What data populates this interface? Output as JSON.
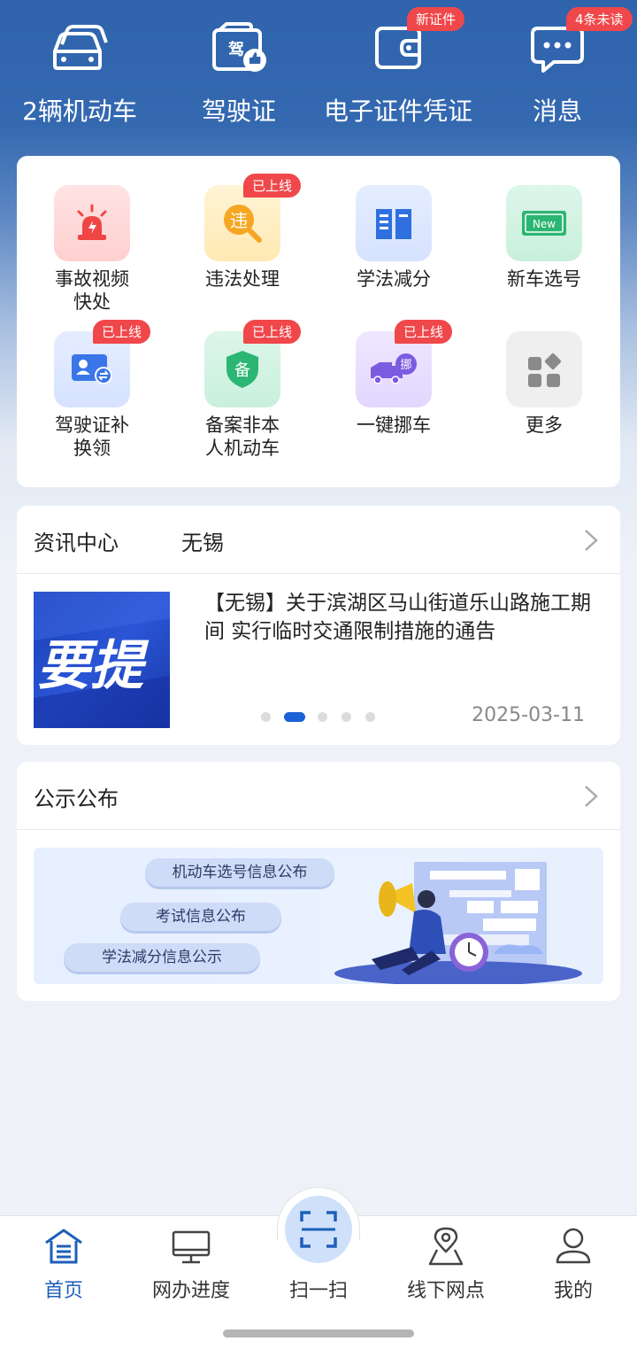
{
  "header": {
    "items": [
      {
        "label": "2辆机动车",
        "icon": "car-icon",
        "badge": ""
      },
      {
        "label": "驾驶证",
        "icon": "license-icon",
        "badge": ""
      },
      {
        "label": "电子证件凭证",
        "icon": "wallet-icon",
        "badge": "新证件"
      },
      {
        "label": "消息",
        "icon": "message-icon",
        "badge": "4条未读"
      }
    ]
  },
  "services": {
    "items": [
      {
        "label": "事故视频快处",
        "icon": "siren-icon",
        "badge": ""
      },
      {
        "label": "违法处理",
        "icon": "violation-icon",
        "badge": "已上线",
        "glyph": "违"
      },
      {
        "label": "学法减分",
        "icon": "book-icon",
        "badge": ""
      },
      {
        "label": "新车选号",
        "icon": "new-plate-icon",
        "badge": "",
        "glyph": "New"
      },
      {
        "label": "驾驶证补换领",
        "icon": "license-replace-icon",
        "badge": "已上线"
      },
      {
        "label": "备案非本人机动车",
        "icon": "record-shield-icon",
        "badge": "已上线",
        "glyph": "备"
      },
      {
        "label": "一键挪车",
        "icon": "move-truck-icon",
        "badge": "已上线",
        "glyph": "挪"
      },
      {
        "label": "更多",
        "icon": "more-grid-icon",
        "badge": ""
      }
    ]
  },
  "news": {
    "title": "资讯中心",
    "city": "无锡",
    "thumb_text": "要提",
    "headline": "【无锡】关于滨湖区马山街道乐山路施工期间 实行临时交通限制措施的通告",
    "date": "2025-03-11",
    "carousel": {
      "count": 5,
      "active_index": 1
    }
  },
  "notice": {
    "title": "公示公布",
    "pills": [
      "机动车选号信息公布",
      "考试信息公布",
      "学法减分信息公示"
    ]
  },
  "tabbar": {
    "items": [
      {
        "label": "首页",
        "icon": "home-icon",
        "active": true
      },
      {
        "label": "网办进度",
        "icon": "monitor-icon",
        "active": false
      },
      {
        "label": "扫一扫",
        "icon": "scan-icon",
        "active": false
      },
      {
        "label": "线下网点",
        "icon": "map-pin-icon",
        "active": false
      },
      {
        "label": "我的",
        "icon": "user-icon",
        "active": false
      }
    ]
  },
  "colors": {
    "header_blue": "#2f64ad",
    "badge_red": "#f0474a",
    "accent_blue": "#1e5fb8"
  }
}
